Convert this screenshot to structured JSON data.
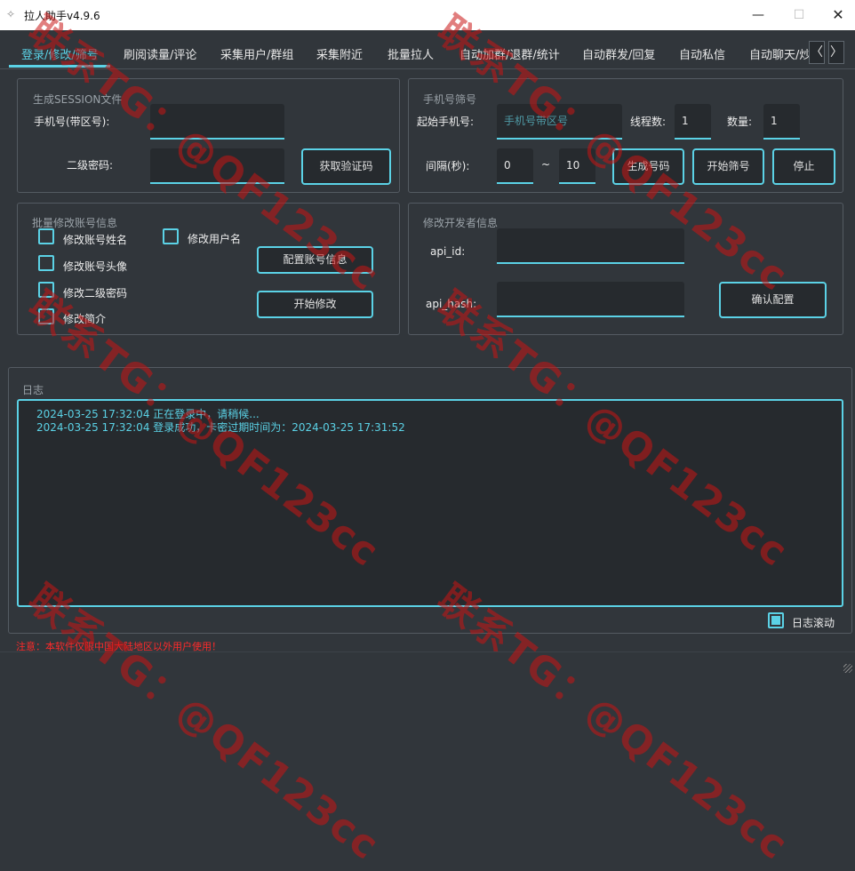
{
  "window": {
    "title": "拉人助手v4.9.6",
    "min_label": "—",
    "max_label": "☐",
    "close_label": "✕"
  },
  "tabs": [
    {
      "label": "登录/修改/筛号",
      "active": true
    },
    {
      "label": "刷阅读量/评论"
    },
    {
      "label": "采集用户/群组"
    },
    {
      "label": "采集附近"
    },
    {
      "label": "批量拉人"
    },
    {
      "label": "自动加群/退群/统计"
    },
    {
      "label": "自动群发/回复"
    },
    {
      "label": "自动私信"
    },
    {
      "label": "自动聊天/炒"
    }
  ],
  "tab_scroll": {
    "left": "〈",
    "right": "〉"
  },
  "session": {
    "title": "生成SESSION文件",
    "phone_label": "手机号(带区号):",
    "phone_value": "",
    "password_label": "二级密码:",
    "password_value": "",
    "get_code_button": "获取验证码"
  },
  "filter": {
    "title": "手机号筛号",
    "start_label": "起始手机号:",
    "start_placeholder": "手机号带区号",
    "threads_label": "线程数:",
    "threads_value": "1",
    "count_label": "数量:",
    "count_value": "1",
    "interval_label": "间隔(秒):",
    "interval_from": "0",
    "interval_sep": "~",
    "interval_to": "10",
    "generate_button": "生成号码",
    "start_button": "开始筛号",
    "stop_button": "停止"
  },
  "batch": {
    "title": "批量修改账号信息",
    "opt_name": "修改账号姓名",
    "opt_username": "修改用户名",
    "opt_avatar": "修改账号头像",
    "opt_password": "修改二级密码",
    "opt_bio": "修改简介",
    "config_button": "配置账号信息",
    "start_button": "开始修改"
  },
  "dev": {
    "title": "修改开发者信息",
    "api_id_label": "api_id:",
    "api_id_value": "",
    "api_hash_label": "api_hash:",
    "api_hash_value": "",
    "confirm_button": "确认配置"
  },
  "log": {
    "title": "日志",
    "lines": [
      "2024-03-25 17:32:04 正在登录中，请稍候...",
      "2024-03-25 17:32:04 登录成功，卡密过期时间为：2024-03-25 17:31:52"
    ],
    "autoscroll_label": "日志滚动",
    "autoscroll_checked": true
  },
  "notice": "注意：本软件仅限中国大陆地区以外用户使用！",
  "watermark_text": "联系TG：@QF123cc",
  "colors": {
    "accent": "#5bd2e6",
    "background": "#31363b",
    "input_bg": "#262a2e",
    "warning": "#ff2a2a",
    "watermark": "#c81414"
  }
}
